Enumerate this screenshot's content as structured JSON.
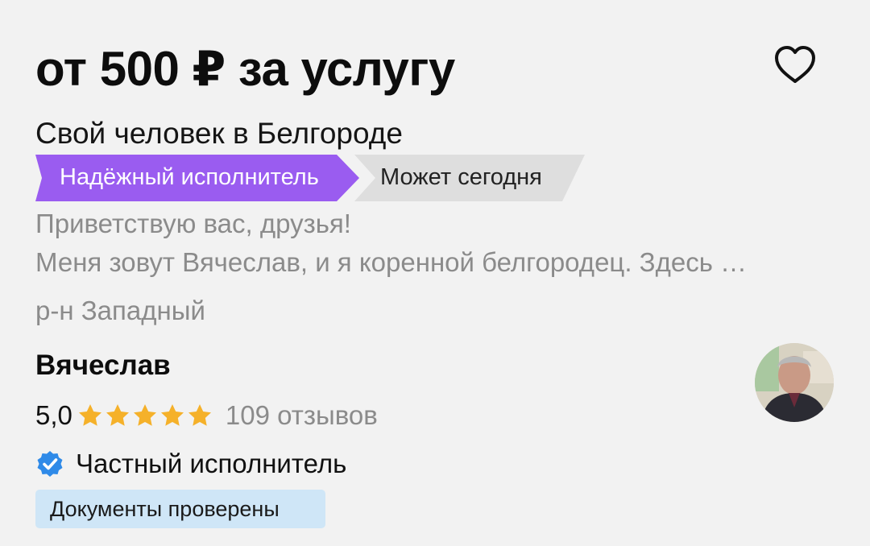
{
  "listing": {
    "price": "от 500 ₽ за услугу",
    "title": "Свой человек в Белгороде",
    "tags": {
      "reliable": "Надёжный исполнитель",
      "today": "Может сегодня"
    },
    "description": {
      "line1": "Приветствую вас, друзья!",
      "line2": "Меня зовут Вячеслав, и я коренной белгородец. Здесь …"
    },
    "district": "р-н Западный"
  },
  "provider": {
    "name": "Вячеслав",
    "rating": "5,0",
    "stars": 5,
    "reviews": "109 отзывов",
    "status": "Частный исполнитель",
    "documents_badge": "Документы проверены"
  },
  "icons": {
    "favorite": "heart-outline-icon",
    "star": "star-icon",
    "verified": "verified-check-icon"
  },
  "colors": {
    "reliable_tag": "#9a5cf0",
    "today_tag": "#dedede",
    "star": "#f5b12a",
    "verified": "#2f8ae8",
    "documents_badge": "#cfe6f7"
  }
}
